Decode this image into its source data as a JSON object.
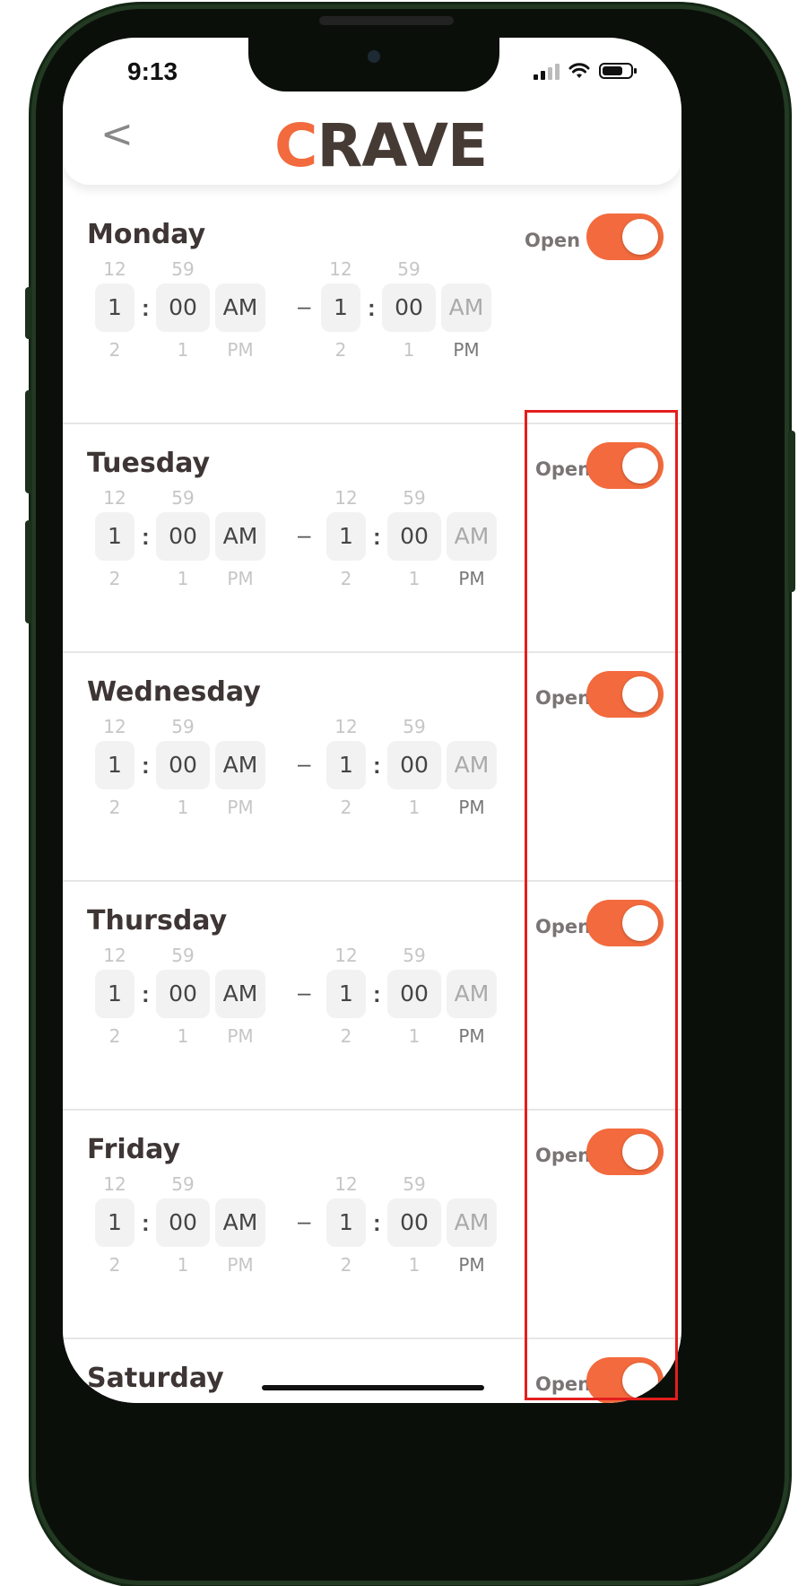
{
  "status": {
    "time": "9:13"
  },
  "header": {
    "back": "<",
    "logo_first": "C",
    "logo_rest": "RAVE"
  },
  "colors": {
    "accent": "#f26a3d",
    "brand_dark": "#463a35",
    "highlight": "#e41e1e"
  },
  "open_label": "Open",
  "days": [
    {
      "name": "Monday",
      "open": true
    },
    {
      "name": "Tuesday",
      "open": true
    },
    {
      "name": "Wednesday",
      "open": true
    },
    {
      "name": "Thursday",
      "open": true
    },
    {
      "name": "Friday",
      "open": true
    },
    {
      "name": "Saturday",
      "open": true
    }
  ],
  "picker": {
    "hour": {
      "above": "12",
      "selected": "1",
      "below": "2"
    },
    "minute": {
      "above": "59",
      "selected": "00",
      "below": "1"
    },
    "ampm": {
      "above": "",
      "selected": "AM",
      "below": "PM"
    },
    "separator": ":",
    "range_dash": "–"
  }
}
